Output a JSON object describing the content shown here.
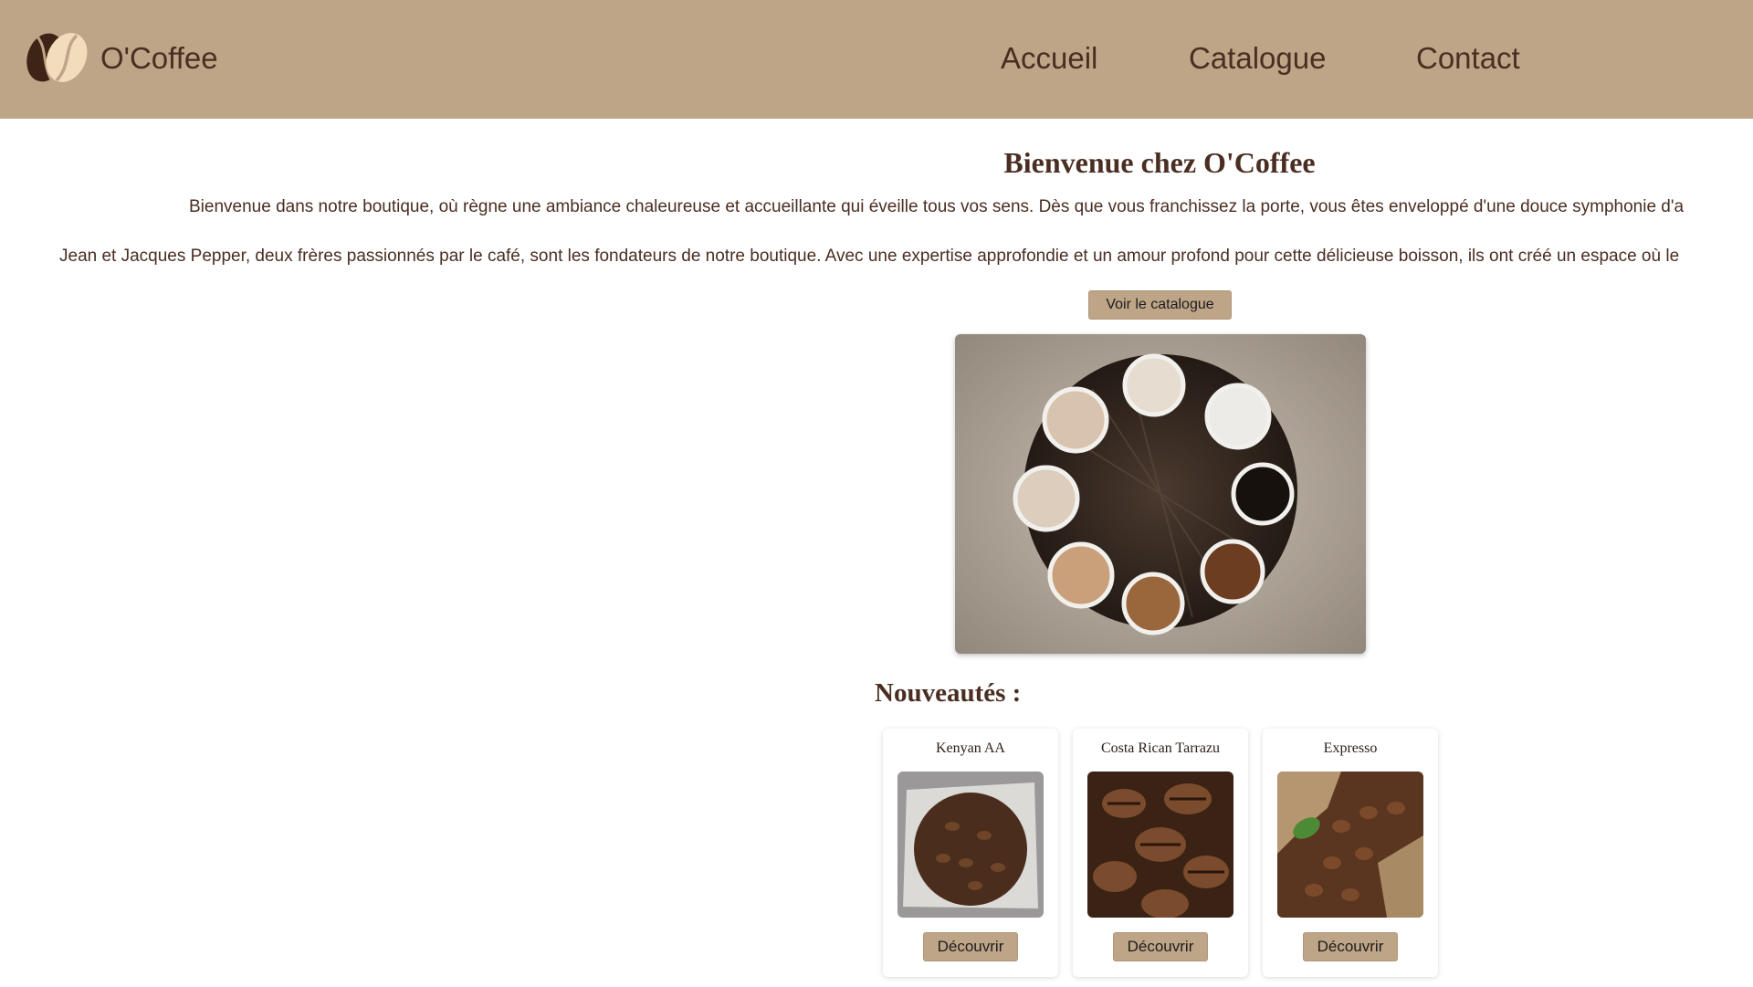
{
  "header": {
    "brand": "O'Coffee",
    "nav": [
      "Accueil",
      "Catalogue",
      "Contact"
    ]
  },
  "hero": {
    "title": "Bienvenue chez O'Coffee",
    "paragraphs": [
      "Bienvenue dans notre boutique, où règne une ambiance chaleureuse et accueillante qui éveille tous vos sens. Dès que vous franchissez la porte, vous êtes enveloppé d'une douce symphonie d'a",
      "Jean et Jacques Pepper, deux frères passionnés par le café, sont les fondateurs de notre boutique. Avec une expertise approfondie et un amour profond pour cette délicieuse boisson, ils ont créé un espace où le"
    ],
    "cta_label": "Voir le catalogue"
  },
  "new_products": {
    "title": "Nouveautés :",
    "items": [
      {
        "name": "Kenyan AA",
        "button": "Découvrir"
      },
      {
        "name": "Costa Rican Tarrazu",
        "button": "Découvrir"
      },
      {
        "name": "Expresso",
        "button": "Découvrir"
      }
    ]
  },
  "colors": {
    "header_bg": "#bfa588",
    "text": "#4a2e22",
    "button_bg": "#bfa588"
  }
}
